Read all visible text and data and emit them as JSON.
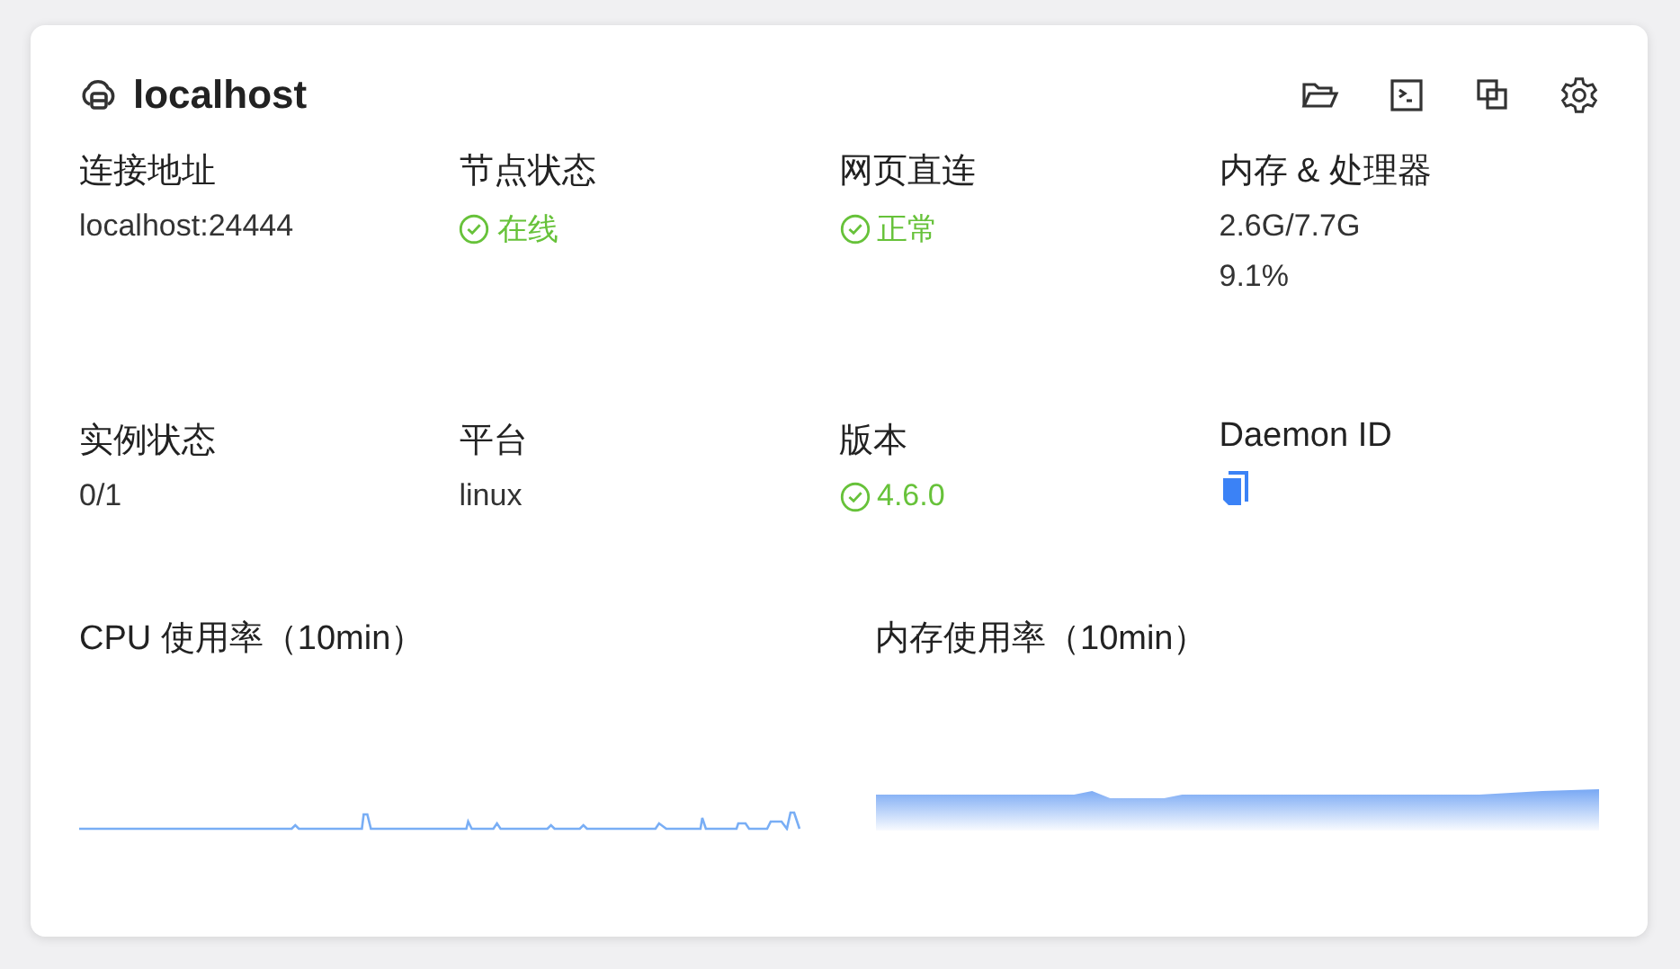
{
  "card": {
    "title": "localhost"
  },
  "toolbar": [
    {
      "kind": "folder"
    },
    {
      "kind": "terminal"
    },
    {
      "kind": "copy"
    },
    {
      "kind": "settings"
    }
  ],
  "fields": [
    {
      "label": "连接地址",
      "values": [
        {
          "kind": "text",
          "text": "localhost:24444"
        }
      ]
    },
    {
      "label": "节点状态",
      "values": [
        {
          "kind": "ok",
          "text": "在线"
        }
      ]
    },
    {
      "label": "网页直连",
      "values": [
        {
          "kind": "ok",
          "text": "正常"
        }
      ]
    },
    {
      "label": "内存 & 处理器",
      "values": [
        {
          "kind": "text",
          "text": "2.6G/7.7G"
        },
        {
          "kind": "text",
          "text": "9.1%"
        }
      ]
    },
    {
      "label": "实例状态",
      "values": [
        {
          "kind": "text",
          "text": "0/1"
        }
      ]
    },
    {
      "label": "平台",
      "values": [
        {
          "kind": "text",
          "text": "linux"
        }
      ]
    },
    {
      "label": "版本",
      "values": [
        {
          "kind": "ok",
          "text": "4.6.0"
        }
      ]
    },
    {
      "label": "Daemon ID",
      "values": [
        {
          "kind": "copy"
        }
      ]
    }
  ],
  "charts": [
    {
      "title": "CPU 使用率（10min）",
      "kind": "line"
    },
    {
      "title": "内存使用率（10min）",
      "kind": "area"
    }
  ]
}
